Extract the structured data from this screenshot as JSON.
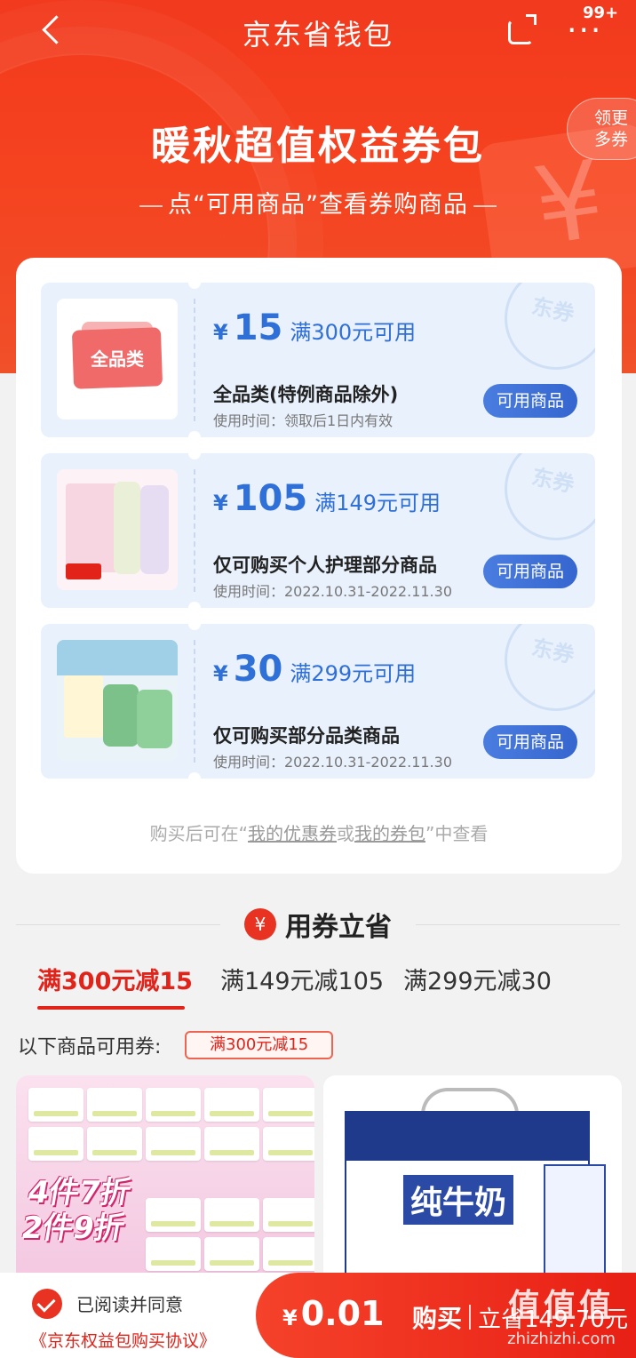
{
  "nav": {
    "title": "京东省钱包",
    "badge": "99+"
  },
  "hero": {
    "title": "暖秋超值权益券包",
    "subtitle": "点“可用商品”查看券购商品",
    "get_more": [
      "领更",
      "多券"
    ]
  },
  "coupons": [
    {
      "yen": "¥",
      "amount": "15",
      "condition": "满300元可用",
      "name": "全品类(特例商品除外)",
      "time": "使用时间：领取后1日内有效",
      "button": "可用商品",
      "stamp": "东券",
      "thumb_label": "全品类"
    },
    {
      "yen": "¥",
      "amount": "105",
      "condition": "满149元可用",
      "name": "仅可购买个人护理部分商品",
      "time": "使用时间：2022.10.31-2022.11.30",
      "button": "可用商品",
      "stamp": "东券",
      "thumb_label": ""
    },
    {
      "yen": "¥",
      "amount": "30",
      "condition": "满299元可用",
      "name": "仅可购买部分品类商品",
      "time": "使用时间：2022.10.31-2022.11.30",
      "button": "可用商品",
      "stamp": "东券",
      "thumb_label": ""
    }
  ],
  "note": {
    "prefix": "购买后可在“",
    "link1": "我的优惠券",
    "mid": "或",
    "link2": "我的券包",
    "suffix": "”中查看"
  },
  "section": {
    "icon": "¥",
    "title": "用券立省"
  },
  "tabs": [
    "满300元减15",
    "满149元减105",
    "满299元减30"
  ],
  "available": {
    "label": "以下商品可用券:",
    "tag": "满300元减15"
  },
  "products": {
    "left_promo": [
      "4件7折",
      "2件9折"
    ],
    "right_title": "纯牛奶"
  },
  "bottom": {
    "agree": "已阅读并同意",
    "agreement_link": "《京东权益包购买协议》",
    "yen": "¥",
    "price": "0.01",
    "buy": "购买",
    "save": "立省149.70元"
  },
  "watermark": {
    "big": "值值值",
    "small": "zhizhizhi.com"
  },
  "colors": {
    "brand_red": "#e2231a",
    "coupon_blue": "#2f6fd8",
    "coupon_bg": "#e9f1fc"
  }
}
